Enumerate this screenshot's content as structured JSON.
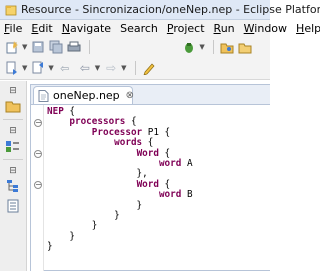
{
  "window": {
    "title": "Resource - Sincronizacion/oneNep.nep - Eclipse Platform",
    "icon": "eclipse-resource-icon"
  },
  "menu": {
    "items": [
      {
        "mnemonic": "F",
        "rest": "ile"
      },
      {
        "mnemonic": "E",
        "rest": "dit"
      },
      {
        "mnemonic": "N",
        "rest": "avigate"
      },
      {
        "mnemonic": "",
        "rest": "Search"
      },
      {
        "mnemonic": "P",
        "rest": "roject"
      },
      {
        "mnemonic": "R",
        "rest": "un"
      },
      {
        "mnemonic": "W",
        "rest": "indow"
      },
      {
        "mnemonic": "H",
        "rest": "elp"
      }
    ]
  },
  "toolbar": {
    "icons": [
      "new-icon",
      "save-icon",
      "save-all-icon",
      "print-icon",
      "debug-icon",
      "open-type-icon",
      "open-resource-icon",
      "next-annotation-icon",
      "prev-annotation-icon",
      "back-icon",
      "forward-icon",
      "pin-icon",
      "edit-icon"
    ]
  },
  "editor": {
    "tab": {
      "label": "oneNep.nep",
      "close": "⊗"
    },
    "code_lines": [
      [
        {
          "t": "NEP",
          "c": "kw"
        },
        {
          "t": " {",
          "c": ""
        }
      ],
      [
        {
          "t": "    ",
          "c": ""
        },
        {
          "t": "processors",
          "c": "kw"
        },
        {
          "t": " {",
          "c": ""
        }
      ],
      [
        {
          "t": "        ",
          "c": ""
        },
        {
          "t": "Processor",
          "c": "kw"
        },
        {
          "t": " P1 {",
          "c": ""
        }
      ],
      [
        {
          "t": "            ",
          "c": ""
        },
        {
          "t": "words",
          "c": "kw"
        },
        {
          "t": " {",
          "c": ""
        }
      ],
      [
        {
          "t": "                ",
          "c": ""
        },
        {
          "t": "Word",
          "c": "kw"
        },
        {
          "t": " {",
          "c": ""
        }
      ],
      [
        {
          "t": "                    ",
          "c": ""
        },
        {
          "t": "word",
          "c": "kw"
        },
        {
          "t": " A",
          "c": ""
        }
      ],
      [
        {
          "t": "                },",
          "c": ""
        }
      ],
      [
        {
          "t": "                ",
          "c": ""
        },
        {
          "t": "Word",
          "c": "kw"
        },
        {
          "t": " {",
          "c": ""
        }
      ],
      [
        {
          "t": "                    ",
          "c": ""
        },
        {
          "t": "word",
          "c": "kw"
        },
        {
          "t": " B",
          "c": ""
        }
      ],
      [
        {
          "t": "                }",
          "c": ""
        }
      ],
      [
        {
          "t": "            }",
          "c": ""
        }
      ],
      [
        {
          "t": "        }",
          "c": ""
        }
      ],
      [
        {
          "t": "    }",
          "c": ""
        }
      ],
      [
        {
          "t": "}",
          "c": ""
        }
      ]
    ]
  },
  "colors": {
    "keyword": "#7f0055",
    "titlebar": "#dfe8f6",
    "chrome": "#f3f3f3"
  }
}
